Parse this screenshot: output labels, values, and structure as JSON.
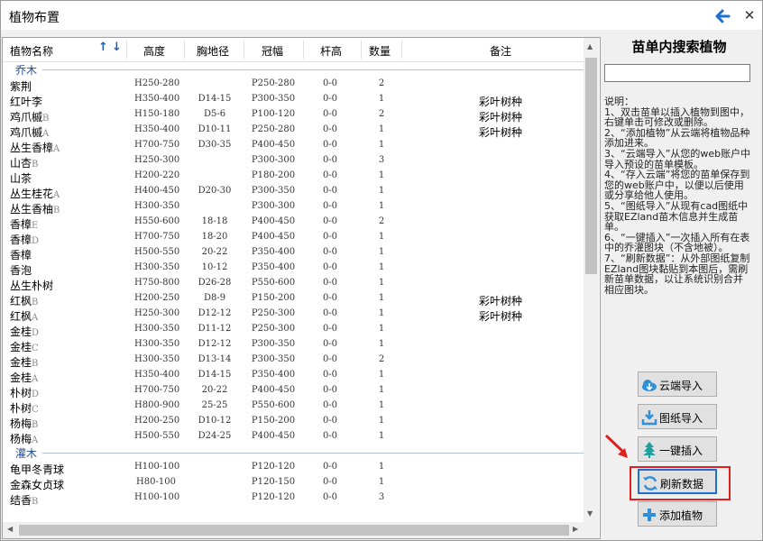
{
  "window": {
    "title": "植物布置",
    "close_glyph": "✕",
    "back_icon": "back-arrow-icon"
  },
  "table": {
    "headers": {
      "name": "植物名称",
      "height": "高度",
      "dbh": "胸地径",
      "crown": "冠幅",
      "pole": "杆高",
      "qty": "数量",
      "note": "备注"
    },
    "sort_up": "↑",
    "sort_down": "↓",
    "groups": [
      {
        "label": "乔木",
        "rows": [
          {
            "name": "紫荆",
            "suffix": "",
            "height": "H250-280",
            "dbh": "",
            "crown": "P250-280",
            "pole": "0-0",
            "qty": "2",
            "note": ""
          },
          {
            "name": "红叶李",
            "suffix": "",
            "height": "H350-400",
            "dbh": "D14-15",
            "crown": "P300-350",
            "pole": "0-0",
            "qty": "1",
            "note": "彩叶树种"
          },
          {
            "name": "鸡爪槭",
            "suffix": "B",
            "height": "H150-180",
            "dbh": "D5-6",
            "crown": "P100-120",
            "pole": "0-0",
            "qty": "2",
            "note": "彩叶树种"
          },
          {
            "name": "鸡爪槭",
            "suffix": "A",
            "height": "H350-400",
            "dbh": "D10-11",
            "crown": "P250-280",
            "pole": "0-0",
            "qty": "1",
            "note": "彩叶树种"
          },
          {
            "name": "丛生香樟",
            "suffix": "A",
            "height": "H700-750",
            "dbh": "D30-35",
            "crown": "P400-450",
            "pole": "0-0",
            "qty": "1",
            "note": ""
          },
          {
            "name": "山杏",
            "suffix": "B",
            "height": "H250-300",
            "dbh": "",
            "crown": "P300-300",
            "pole": "0-0",
            "qty": "3",
            "note": ""
          },
          {
            "name": "山茶",
            "suffix": "",
            "height": "H200-220",
            "dbh": "",
            "crown": "P180-200",
            "pole": "0-0",
            "qty": "1",
            "note": ""
          },
          {
            "name": "丛生桂花",
            "suffix": "A",
            "height": "H400-450",
            "dbh": "D20-30",
            "crown": "P300-350",
            "pole": "0-0",
            "qty": "1",
            "note": ""
          },
          {
            "name": "丛生香柚",
            "suffix": "B",
            "height": "H300-350",
            "dbh": "",
            "crown": "P300-300",
            "pole": "0-0",
            "qty": "1",
            "note": ""
          },
          {
            "name": "香樟",
            "suffix": "E",
            "height": "H550-600",
            "dbh": "18-18",
            "crown": "P400-450",
            "pole": "0-0",
            "qty": "2",
            "note": ""
          },
          {
            "name": "香樟",
            "suffix": "D",
            "height": "H700-750",
            "dbh": "18-20",
            "crown": "P400-450",
            "pole": "0-0",
            "qty": "1",
            "note": ""
          },
          {
            "name": "香樟",
            "suffix": "",
            "height": "H500-550",
            "dbh": "20-22",
            "crown": "P350-400",
            "pole": "0-0",
            "qty": "1",
            "note": ""
          },
          {
            "name": "香泡",
            "suffix": "",
            "height": "H300-350",
            "dbh": "10-12",
            "crown": "P350-400",
            "pole": "0-0",
            "qty": "1",
            "note": ""
          },
          {
            "name": "丛生朴树",
            "suffix": "",
            "height": "H750-800",
            "dbh": "D26-28",
            "crown": "P550-600",
            "pole": "0-0",
            "qty": "1",
            "note": ""
          },
          {
            "name": "红枫",
            "suffix": "B",
            "height": "H200-250",
            "dbh": "D8-9",
            "crown": "P150-200",
            "pole": "0-0",
            "qty": "1",
            "note": "彩叶树种"
          },
          {
            "name": "红枫",
            "suffix": "A",
            "height": "H250-300",
            "dbh": "D12-12",
            "crown": "P250-300",
            "pole": "0-0",
            "qty": "1",
            "note": "彩叶树种"
          },
          {
            "name": "金桂",
            "suffix": "D",
            "height": "H300-350",
            "dbh": "D11-12",
            "crown": "P250-300",
            "pole": "0-0",
            "qty": "1",
            "note": ""
          },
          {
            "name": "金桂",
            "suffix": "C",
            "height": "H300-350",
            "dbh": "D12-12",
            "crown": "P300-350",
            "pole": "0-0",
            "qty": "1",
            "note": ""
          },
          {
            "name": "金桂",
            "suffix": "B",
            "height": "H300-350",
            "dbh": "D13-14",
            "crown": "P300-350",
            "pole": "0-0",
            "qty": "2",
            "note": ""
          },
          {
            "name": "金桂",
            "suffix": "A",
            "height": "H350-400",
            "dbh": "D14-15",
            "crown": "P350-400",
            "pole": "0-0",
            "qty": "1",
            "note": ""
          },
          {
            "name": "朴树",
            "suffix": "D",
            "height": "H700-750",
            "dbh": "20-22",
            "crown": "P400-450",
            "pole": "0-0",
            "qty": "1",
            "note": ""
          },
          {
            "name": "朴树",
            "suffix": "C",
            "height": "H800-900",
            "dbh": "25-25",
            "crown": "P550-600",
            "pole": "0-0",
            "qty": "1",
            "note": ""
          },
          {
            "name": "杨梅",
            "suffix": "B",
            "height": "H200-250",
            "dbh": "D10-12",
            "crown": "P150-200",
            "pole": "0-0",
            "qty": "1",
            "note": ""
          },
          {
            "name": "杨梅",
            "suffix": "A",
            "height": "H500-550",
            "dbh": "D24-25",
            "crown": "P400-450",
            "pole": "0-0",
            "qty": "1",
            "note": ""
          }
        ]
      },
      {
        "label": "灌木",
        "rows": [
          {
            "name": "龟甲冬青球",
            "suffix": "",
            "height": "H100-100",
            "dbh": "",
            "crown": "P120-120",
            "pole": "0-0",
            "qty": "1",
            "note": ""
          },
          {
            "name": "金森女贞球",
            "suffix": "",
            "height": "H80-100",
            "dbh": "",
            "crown": "P120-150",
            "pole": "0-0",
            "qty": "1",
            "note": ""
          },
          {
            "name": "结香",
            "suffix": "B",
            "height": "H100-100",
            "dbh": "",
            "crown": "P120-120",
            "pole": "0-0",
            "qty": "3",
            "note": ""
          }
        ]
      }
    ]
  },
  "side": {
    "title": "苗单内搜索植物",
    "search_value": "",
    "help": [
      "说明：",
      "1、双击苗单以插入植物到图中，右键单击可修改或删除。",
      "2、“添加植物”从云端将植物品种添加进来。",
      "3、“云端导入”从您的web账户中导入预设的苗单模板。",
      "4、“存入云端”将您的苗单保存到您的web账户中，以便以后使用或分享给他人使用。",
      "5、“图纸导入”从现有cad图纸中获取EZland苗木信息并生成苗单。",
      "6、“一键插入”一次插入所有在表中的乔灌图块（不含地被）。",
      "7、“刷新数据”：从外部图纸复制EZland图块黏贴到本图后，需刷新苗单数据，以让系统识别合并相应图块。"
    ],
    "buttons": {
      "cloud_import": "云端导入",
      "drawing_import": "图纸导入",
      "one_click_insert": "一键插入",
      "refresh": "刷新数据",
      "add_plant": "添加植物"
    }
  },
  "colors": {
    "accent": "#1d6fd0",
    "highlight": "#e02020",
    "group_label": "#1f4f9a"
  }
}
